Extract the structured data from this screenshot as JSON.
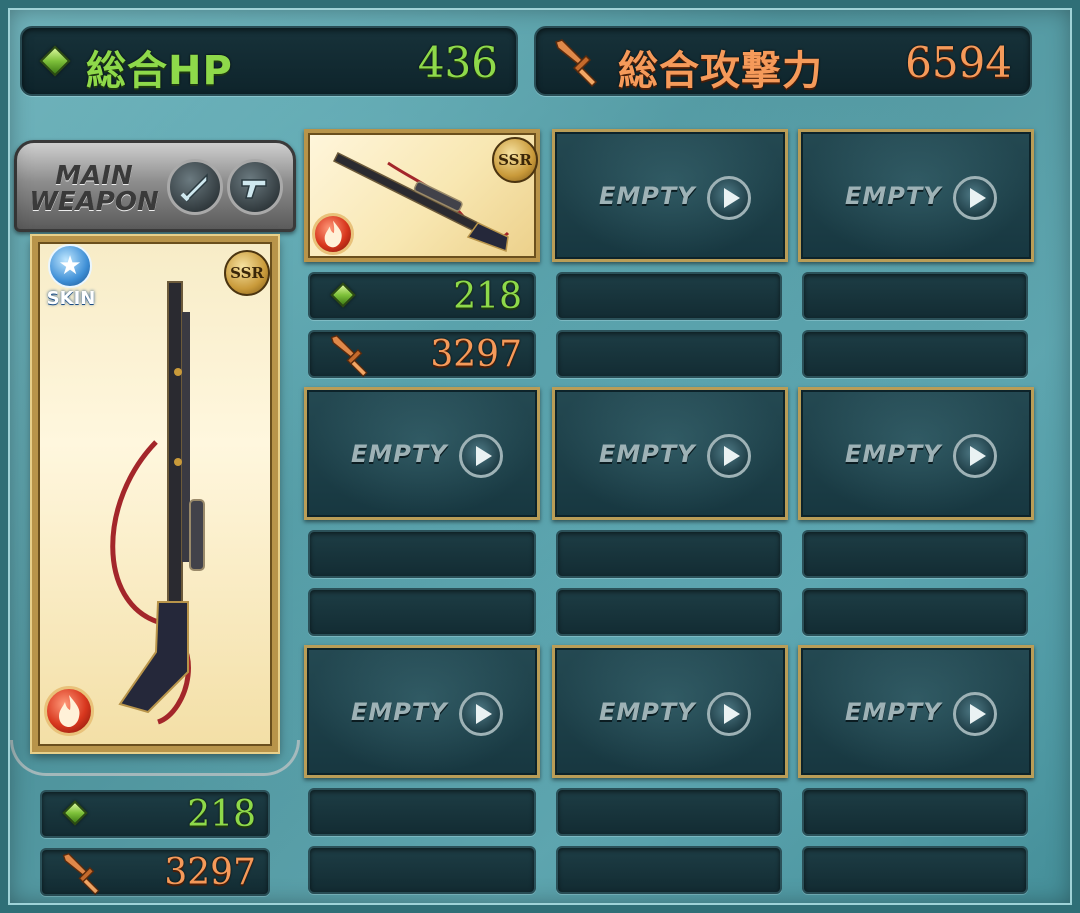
{
  "summary": {
    "total_hp_label": "総合HP",
    "total_hp_value": "436",
    "total_atk_label": "総合攻撃力",
    "total_atk_value": "6594"
  },
  "main_weapon": {
    "header_label_line1": "MAIN",
    "header_label_line2": "WEAPON",
    "skin_label": "SKIN",
    "rarity": "SSR",
    "element": "fire",
    "hp": "218",
    "atk": "3297"
  },
  "sub_weapons": {
    "empty_label": "EMPTY",
    "slots": [
      {
        "state": "filled",
        "rarity": "SSR",
        "element": "fire",
        "hp": "218",
        "atk": "3297"
      },
      {
        "state": "empty",
        "hp": "",
        "atk": ""
      },
      {
        "state": "empty",
        "hp": "",
        "atk": ""
      },
      {
        "state": "empty",
        "hp": "",
        "atk": ""
      },
      {
        "state": "empty",
        "hp": "",
        "atk": ""
      },
      {
        "state": "empty",
        "hp": "",
        "atk": ""
      },
      {
        "state": "empty",
        "hp": "",
        "atk": ""
      },
      {
        "state": "empty",
        "hp": "",
        "atk": ""
      },
      {
        "state": "empty",
        "hp": "",
        "atk": ""
      }
    ]
  },
  "icons": {
    "hp": "green-gem-icon",
    "atk": "sword-icon",
    "element": "fire-element-icon",
    "skin": "star-icon",
    "play": "play-icon"
  },
  "colors": {
    "hp": "#8ed94a",
    "atk": "#f59a5a",
    "slot_border": "#b99d57",
    "background": "#5ea4ad"
  }
}
